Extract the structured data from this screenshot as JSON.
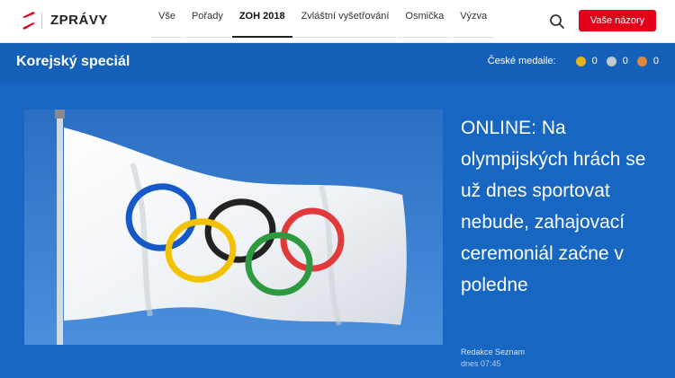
{
  "brand": {
    "name": "ZPRÁVY"
  },
  "nav": {
    "items": [
      {
        "label": "Vše"
      },
      {
        "label": "Pořady"
      },
      {
        "label": "ZOH 2018"
      },
      {
        "label": "Zvláštní vyšetřování"
      },
      {
        "label": "Osmička"
      },
      {
        "label": "Výzva"
      }
    ],
    "active_index": 2
  },
  "header": {
    "search_icon": "search-icon",
    "cta_label": "Vaše názory"
  },
  "section": {
    "title": "Korejský speciál",
    "medals_label": "České medaile:",
    "medals": [
      {
        "kind": "gold",
        "count": "0",
        "color": "#e5b521"
      },
      {
        "kind": "silver",
        "count": "0",
        "color": "#bfc7d0"
      },
      {
        "kind": "bronze",
        "count": "0",
        "color": "#d98a3d"
      }
    ]
  },
  "article": {
    "headline": "ONLINE: Na olympijských hrách se už dnes sportovat nebude, zahajovací ceremoniál začne v poledne",
    "author": "Redakce Seznam",
    "time": "dnes 07:45"
  },
  "colors": {
    "accent_red": "#e2001a",
    "section_blue": "#1560b8",
    "main_blue": "#1766c2"
  }
}
